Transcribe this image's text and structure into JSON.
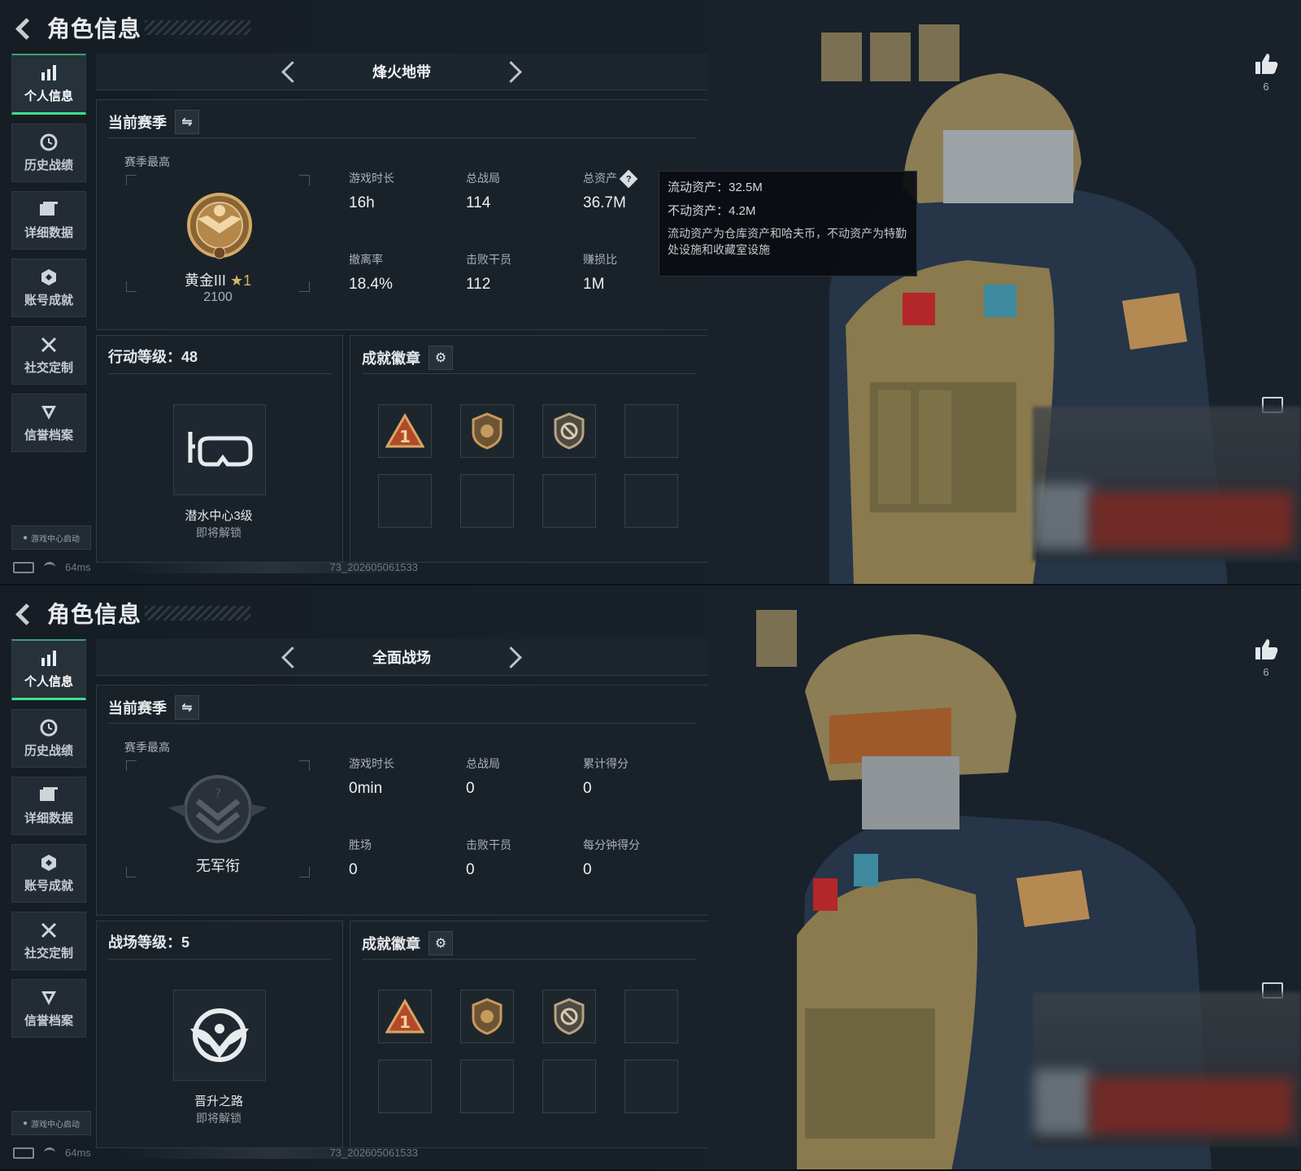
{
  "common": {
    "title": "角色信息",
    "nav": [
      "个人信息",
      "历史战绩",
      "详细数据",
      "账号成就",
      "社交定制",
      "信誉档案"
    ],
    "nav_icons": [
      "bar-chart-icon",
      "history-clock-icon",
      "folder-icon",
      "achievement-icon",
      "tools-icon",
      "reputation-icon"
    ],
    "launcher": "游戏中心启动",
    "ping": "64ms",
    "build": "73_202605061533",
    "season_label": "当前赛季",
    "season_sub": "赛季最高",
    "badges_title": "成就徽章",
    "likes": "6",
    "accent": "#3ee08c"
  },
  "screens": [
    {
      "mode": "烽火地带",
      "rank": {
        "name": "黄金III",
        "stars": "★1",
        "score": "2100"
      },
      "stats": [
        {
          "label": "游戏时长",
          "value": "16h"
        },
        {
          "label": "总战局",
          "value": "114"
        },
        {
          "label": "总资产",
          "value": "36.7M"
        },
        {
          "label": "撤离率",
          "value": "18.4%"
        },
        {
          "label": "击败干员",
          "value": "112"
        },
        {
          "label": "赚损比",
          "value": "1M"
        }
      ],
      "tooltip": {
        "liquid": "流动资产：32.5M",
        "fixed": "不动资产：4.2M",
        "desc": "流动资产为仓库资产和哈夫币，不动资产为特勤处设施和收藏室设施"
      },
      "level": {
        "title": "行动等级：48",
        "item": "潜水中心3级",
        "lock": "即将解锁",
        "icon": "diving-goggles-icon"
      }
    },
    {
      "mode": "全面战场",
      "rank": {
        "name": "无军衔",
        "stars": "",
        "score": ""
      },
      "stats": [
        {
          "label": "游戏时长",
          "value": "0min"
        },
        {
          "label": "总战局",
          "value": "0"
        },
        {
          "label": "累计得分",
          "value": "0"
        },
        {
          "label": "胜场",
          "value": "0"
        },
        {
          "label": "击败干员",
          "value": "0"
        },
        {
          "label": "每分钟得分",
          "value": "0"
        }
      ],
      "level": {
        "title": "战场等级：5",
        "item": "晋升之路",
        "lock": "即将解锁",
        "icon": "eagle-emblem-icon"
      }
    }
  ],
  "badges": [
    "warning-1-badge-icon",
    "bronze-shield-badge-icon",
    "no-entry-shield-badge-icon",
    "",
    "",
    "",
    "",
    ""
  ]
}
